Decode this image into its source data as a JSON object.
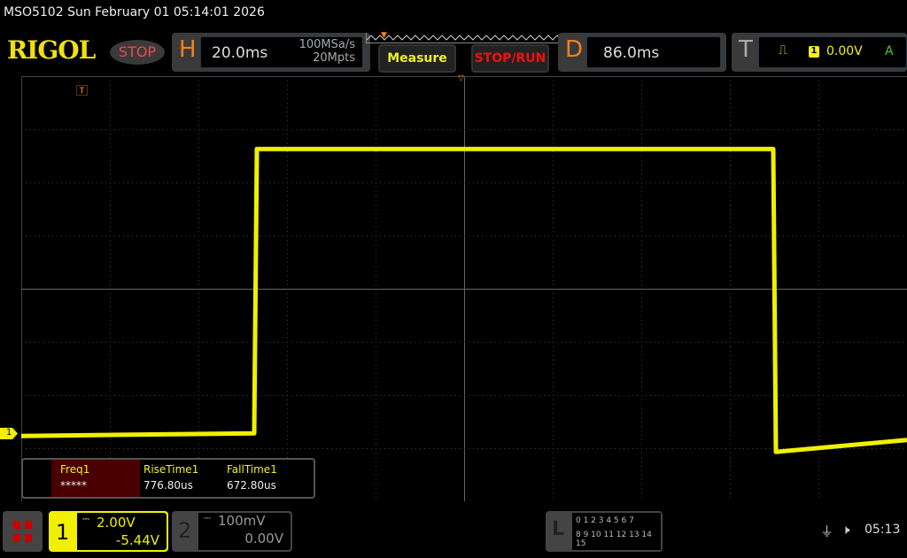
{
  "title": "MSO5102  Sun February 01 05:14:01 2026",
  "logo": "RIGOL",
  "run_state": "STOP",
  "horizontal": {
    "letter": "H",
    "timebase": "20.0ms",
    "sample_rate": "100MSa/s",
    "memory_depth": "20Mpts"
  },
  "buttons": {
    "measure": "Measure",
    "stop_run": "STOP/RUN"
  },
  "delay": {
    "letter": "D",
    "value": "86.0ms"
  },
  "trigger": {
    "letter": "T",
    "source": "1",
    "level": "0.00V",
    "mode": "A",
    "edge": "rising-edge-icon"
  },
  "measurements": [
    {
      "label": "Freq1",
      "value": "*****"
    },
    {
      "label": "RiseTime1",
      "value": "776.80us"
    },
    {
      "label": "FallTime1",
      "value": "672.80us"
    }
  ],
  "channel1": {
    "number": "1",
    "scale": "2.00V",
    "offset": "-5.44V",
    "color": "#f0f000"
  },
  "channel2": {
    "number": "2",
    "scale": "100mV",
    "offset": "0.00V"
  },
  "logic": {
    "letter": "L",
    "row1": "0 1 2 3  4 5 6 7",
    "row2": "8 9 10 11 12 13 14 15"
  },
  "status": {
    "time": "05:13"
  },
  "trace": {
    "unit_x": "ms",
    "unit_y": "V",
    "points": [
      [
        -14,
        -0.1
      ],
      [
        38.6,
        0.0
      ],
      [
        39.2,
        10.7
      ],
      [
        155.8,
        10.7
      ],
      [
        156.4,
        -0.7
      ],
      [
        186,
        -0.25
      ]
    ]
  }
}
